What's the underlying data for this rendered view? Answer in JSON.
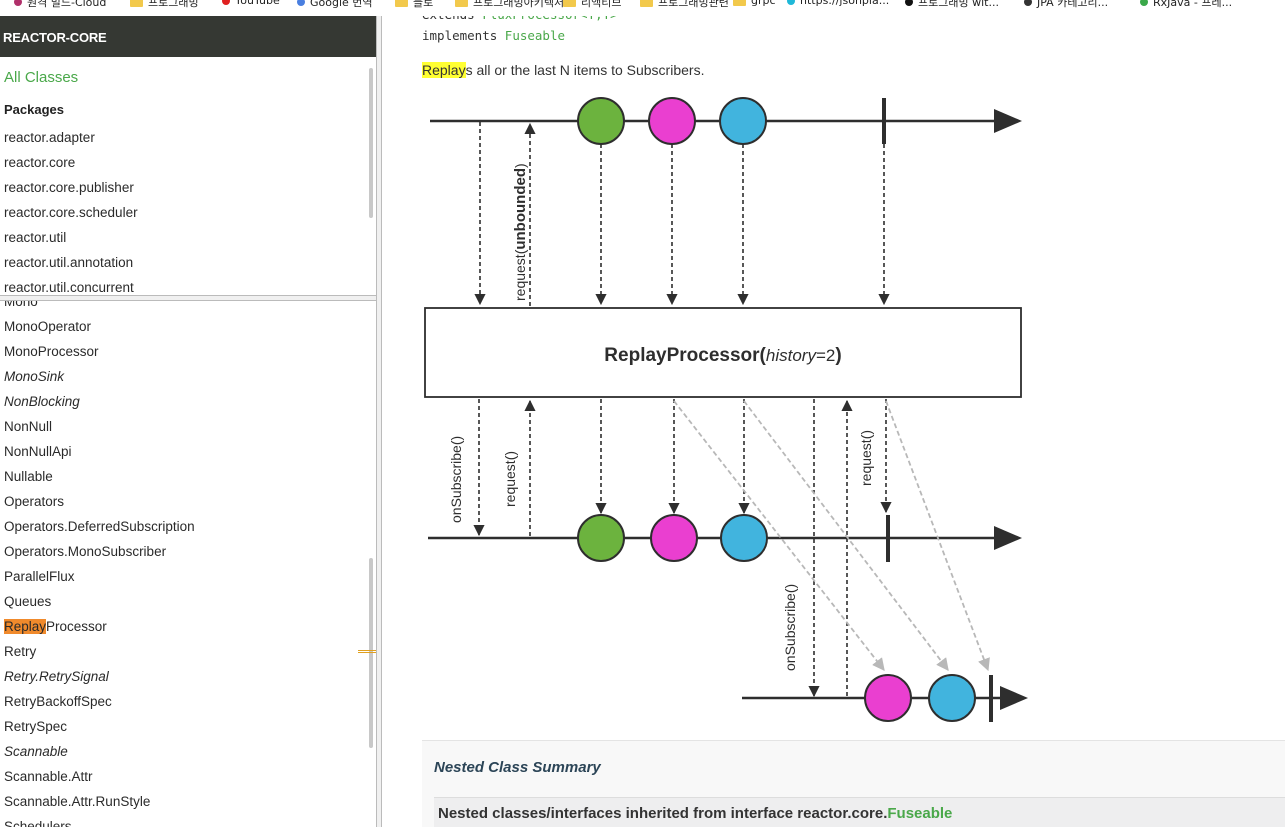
{
  "bookmarks": [
    {
      "label": "원격 빌드-Cloud",
      "icon": "dot",
      "color": "#b0306a"
    },
    {
      "label": "프로그래밍",
      "icon": "folder",
      "color": "#f2c94c"
    },
    {
      "label": "YouTube",
      "icon": "dot",
      "color": "#e02020"
    },
    {
      "label": "Google 번역",
      "icon": "dot",
      "color": "#4a7fe0"
    },
    {
      "label": "블로",
      "icon": "folder",
      "color": "#f2c94c"
    },
    {
      "label": "프로그래밍아키텍처",
      "icon": "folder",
      "color": "#f2c94c"
    },
    {
      "label": "리액티브",
      "icon": "folder",
      "color": "#f2c94c"
    },
    {
      "label": "프로그래밍관련",
      "icon": "folder",
      "color": "#f2c94c"
    },
    {
      "label": "grpc",
      "icon": "folder",
      "color": "#f2c94c"
    },
    {
      "label": "https://jsonpla...",
      "icon": "dot",
      "color": "#1fb8d8"
    },
    {
      "label": "프로그래밍 wit...",
      "icon": "dot",
      "color": "#111111"
    },
    {
      "label": "JPA 카테고리...",
      "icon": "dot",
      "color": "#333333"
    },
    {
      "label": "RxJava - 프레...",
      "icon": "dot",
      "color": "#3aa84a"
    }
  ],
  "left": {
    "header": "REACTOR-CORE",
    "all_classes": "All Classes",
    "packages_title": "Packages",
    "packages": [
      "reactor.adapter",
      "reactor.core",
      "reactor.core.publisher",
      "reactor.core.scheduler",
      "reactor.util",
      "reactor.util.annotation",
      "reactor.util.concurrent"
    ],
    "classes": [
      {
        "name": "Mono",
        "italic": false
      },
      {
        "name": "MonoOperator",
        "italic": false
      },
      {
        "name": "MonoProcessor",
        "italic": false
      },
      {
        "name": "MonoSink",
        "italic": true
      },
      {
        "name": "NonBlocking",
        "italic": true
      },
      {
        "name": "NonNull",
        "italic": false
      },
      {
        "name": "NonNullApi",
        "italic": false
      },
      {
        "name": "Nullable",
        "italic": false
      },
      {
        "name": "Operators",
        "italic": false
      },
      {
        "name": "Operators.DeferredSubscription",
        "italic": false
      },
      {
        "name": "Operators.MonoSubscriber",
        "italic": false
      },
      {
        "name": "ParallelFlux",
        "italic": false
      },
      {
        "name": "Queues",
        "italic": false
      },
      {
        "name": "ReplayProcessor",
        "italic": false,
        "highlight": "Replay",
        "rest": "Processor"
      },
      {
        "name": "Retry",
        "italic": false
      },
      {
        "name": "Retry.RetrySignal",
        "italic": true
      },
      {
        "name": "RetryBackoffSpec",
        "italic": false
      },
      {
        "name": "RetrySpec",
        "italic": false
      },
      {
        "name": "Scannable",
        "italic": true
      },
      {
        "name": "Scannable.Attr",
        "italic": false
      },
      {
        "name": "Scannable.Attr.RunStyle",
        "italic": false
      },
      {
        "name": "Schedulers",
        "italic": false
      }
    ]
  },
  "main": {
    "extends_kw": "extends ",
    "extends_type": "FluxProcessor<T,T>",
    "implements_kw": "implements ",
    "implements_type": "Fuseable",
    "desc_highlight": "Replay",
    "desc_rest": "s all or the last N items to Subscribers.",
    "diagram": {
      "processor_name": "ReplayProcessor(",
      "processor_param": "history",
      "processor_eq": "=",
      "processor_value": "2",
      "processor_close": ")",
      "label_request": "request(",
      "label_unbounded": "unbounded",
      "label_request_close": ")",
      "label_onsubscribe": "onSubscribe()",
      "label_request_plain": "request()",
      "colors": {
        "green": "#6cb33e",
        "magenta": "#ea3fd0",
        "blue": "#41b4de",
        "line": "#2e2e2e",
        "grey_arrow": "#b8b8b8"
      }
    },
    "nested_title": "Nested Class Summary",
    "nested_sub_text": "Nested classes/interfaces inherited from interface reactor.core.",
    "nested_sub_link": "Fuseable"
  }
}
